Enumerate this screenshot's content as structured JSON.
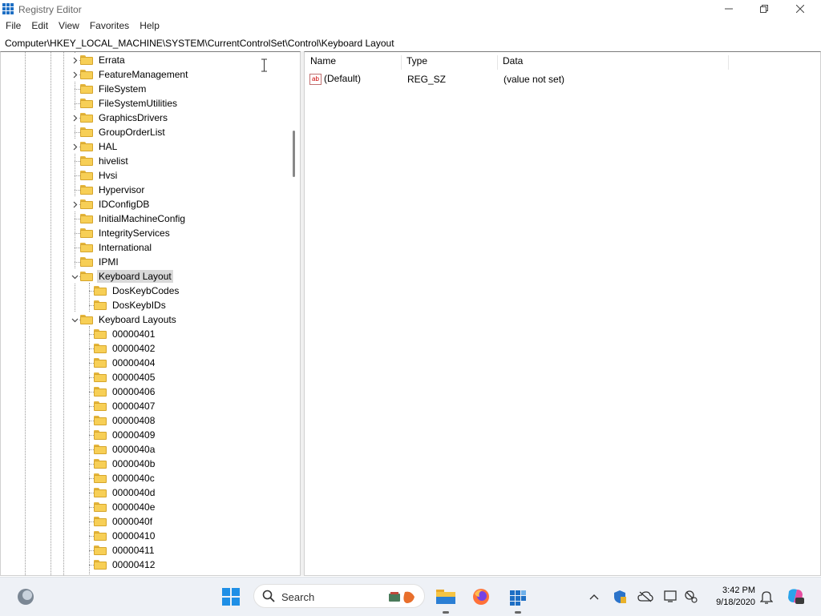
{
  "window": {
    "title": "Registry Editor",
    "minimize_icon": "minimize-icon",
    "restore_icon": "restore-icon",
    "close_icon": "close-icon"
  },
  "menu": [
    "File",
    "Edit",
    "View",
    "Favorites",
    "Help"
  ],
  "address": "Computer\\HKEY_LOCAL_MACHINE\\SYSTEM\\CurrentControlSet\\Control\\Keyboard Layout",
  "tree": {
    "items": [
      {
        "label": "Errata",
        "expander": "collapsed"
      },
      {
        "label": "FeatureManagement",
        "expander": "collapsed"
      },
      {
        "label": "FileSystem",
        "expander": "none"
      },
      {
        "label": "FileSystemUtilities",
        "expander": "none"
      },
      {
        "label": "GraphicsDrivers",
        "expander": "collapsed"
      },
      {
        "label": "GroupOrderList",
        "expander": "none"
      },
      {
        "label": "HAL",
        "expander": "collapsed"
      },
      {
        "label": "hivelist",
        "expander": "none"
      },
      {
        "label": "Hvsi",
        "expander": "none"
      },
      {
        "label": "Hypervisor",
        "expander": "none"
      },
      {
        "label": "IDConfigDB",
        "expander": "collapsed"
      },
      {
        "label": "InitialMachineConfig",
        "expander": "none"
      },
      {
        "label": "IntegrityServices",
        "expander": "none"
      },
      {
        "label": "International",
        "expander": "none"
      },
      {
        "label": "IPMI",
        "expander": "none"
      },
      {
        "label": "Keyboard Layout",
        "expander": "expanded",
        "selected": true
      },
      {
        "label": "DosKeybCodes",
        "expander": "none",
        "child": true
      },
      {
        "label": "DosKeybIDs",
        "expander": "none",
        "child": true
      },
      {
        "label": "Keyboard Layouts",
        "expander": "expanded"
      },
      {
        "label": "00000401",
        "expander": "none",
        "child": true
      },
      {
        "label": "00000402",
        "expander": "none",
        "child": true
      },
      {
        "label": "00000404",
        "expander": "none",
        "child": true
      },
      {
        "label": "00000405",
        "expander": "none",
        "child": true
      },
      {
        "label": "00000406",
        "expander": "none",
        "child": true
      },
      {
        "label": "00000407",
        "expander": "none",
        "child": true
      },
      {
        "label": "00000408",
        "expander": "none",
        "child": true
      },
      {
        "label": "00000409",
        "expander": "none",
        "child": true
      },
      {
        "label": "0000040a",
        "expander": "none",
        "child": true
      },
      {
        "label": "0000040b",
        "expander": "none",
        "child": true
      },
      {
        "label": "0000040c",
        "expander": "none",
        "child": true
      },
      {
        "label": "0000040d",
        "expander": "none",
        "child": true
      },
      {
        "label": "0000040e",
        "expander": "none",
        "child": true
      },
      {
        "label": "0000040f",
        "expander": "none",
        "child": true
      },
      {
        "label": "00000410",
        "expander": "none",
        "child": true
      },
      {
        "label": "00000411",
        "expander": "none",
        "child": true
      },
      {
        "label": "00000412",
        "expander": "none",
        "child": true
      }
    ]
  },
  "list": {
    "columns": [
      "Name",
      "Type",
      "Data"
    ],
    "rows": [
      {
        "name": "(Default)",
        "type": "REG_SZ",
        "data": "(value not set)",
        "icon": "ab"
      }
    ]
  },
  "taskbar": {
    "search_label": "Search",
    "time": "3:42 PM",
    "date": "9/18/2020"
  },
  "colors": {
    "accent": "#0067c0",
    "folder": "#f7cf56",
    "selection": "#d9d9d9"
  }
}
